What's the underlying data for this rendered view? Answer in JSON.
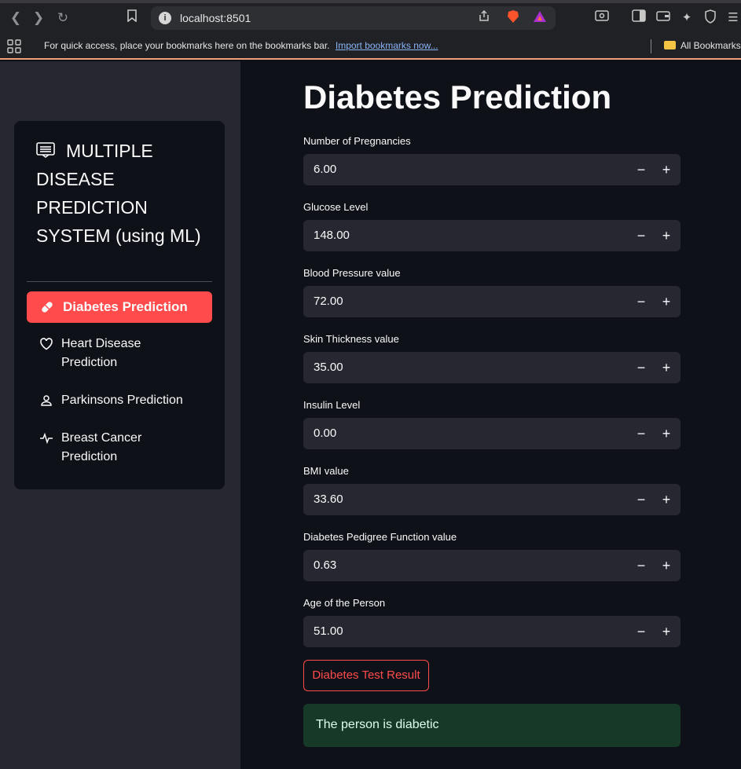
{
  "browser": {
    "url": "localhost:8501",
    "bookmarks_hint": "For quick access, place your bookmarks here on the bookmarks bar.",
    "import_link": "Import bookmarks now...",
    "all_bookmarks": "All Bookmarks"
  },
  "sidebar": {
    "menu_title": "MULTIPLE DISEASE PREDICTION SYSTEM (using ML)",
    "items": [
      {
        "label": "Diabetes Prediction",
        "icon": "capsule-icon",
        "active": true
      },
      {
        "label": "Heart Disease Prediction",
        "icon": "heart-icon",
        "active": false
      },
      {
        "label": "Parkinsons Prediction",
        "icon": "person-icon",
        "active": false
      },
      {
        "label": "Breast Cancer Prediction",
        "icon": "activity-icon",
        "active": false
      }
    ]
  },
  "main": {
    "title": "Diabetes Prediction",
    "fields": [
      {
        "label": "Number of Pregnancies",
        "value": "6.00"
      },
      {
        "label": "Glucose Level",
        "value": "148.00"
      },
      {
        "label": "Blood Pressure value",
        "value": "72.00"
      },
      {
        "label": "Skin Thickness value",
        "value": "35.00"
      },
      {
        "label": "Insulin Level",
        "value": "0.00"
      },
      {
        "label": "BMI value",
        "value": "33.60"
      },
      {
        "label": "Diabetes Pedigree Function value",
        "value": "0.63"
      },
      {
        "label": "Age of the Person",
        "value": "51.00"
      }
    ],
    "stepper_minus": "−",
    "stepper_plus": "+",
    "submit_label": "Diabetes Test Result",
    "result": "The person is diabetic"
  },
  "colors": {
    "accent": "#ff4b4b",
    "sidebar_bg": "#262730",
    "main_bg": "#0e1117",
    "success_bg": "#173928"
  }
}
